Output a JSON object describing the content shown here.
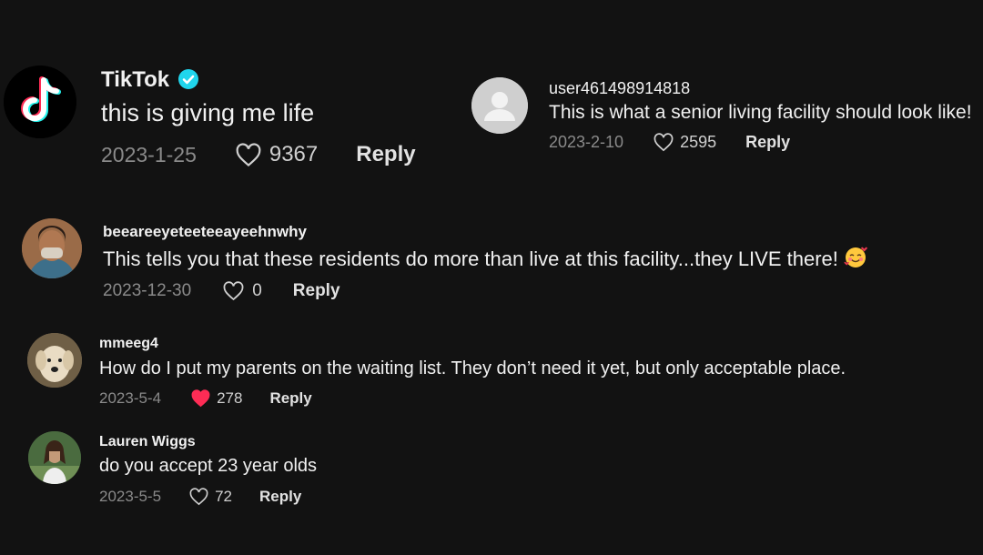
{
  "colors": {
    "background": "#121212",
    "text": "#f1f1f1",
    "muted": "#8a8a8a",
    "liked_heart": "#fe2c55",
    "verified_badge": "#20d5ec"
  },
  "comments": [
    {
      "username": "TikTok",
      "verified": true,
      "text": "this is giving me life",
      "date": "2023-1-25",
      "likes": "9367",
      "liked": false,
      "reply_label": "Reply",
      "avatar_icon": "tiktok-logo-icon"
    },
    {
      "username": "user461498914818",
      "text": "This is what a senior living facility should look like!",
      "date": "2023-2-10",
      "likes": "2595",
      "liked": false,
      "reply_label": "Reply",
      "avatar_icon": "default-user-icon"
    },
    {
      "username": "beeareeyeteeteeayeehnwhy",
      "text": "This tells you that these residents do more than live at this facility...they LIVE there!",
      "emoji": "smiling-face-with-hearts-icon",
      "date": "2023-12-30",
      "likes": "0",
      "liked": false,
      "reply_label": "Reply",
      "avatar_icon": "user-photo"
    },
    {
      "username": "mmeeg4",
      "text": "How do I put my parents on the waiting list. They don’t need it yet, but only acceptable place.",
      "date": "2023-5-4",
      "likes": "278",
      "liked": true,
      "reply_label": "Reply",
      "avatar_icon": "dog-photo"
    },
    {
      "username": "Lauren Wiggs",
      "text": "do you accept 23 year olds",
      "date": "2023-5-5",
      "likes": "72",
      "liked": false,
      "reply_label": "Reply",
      "avatar_icon": "user-photo"
    }
  ]
}
